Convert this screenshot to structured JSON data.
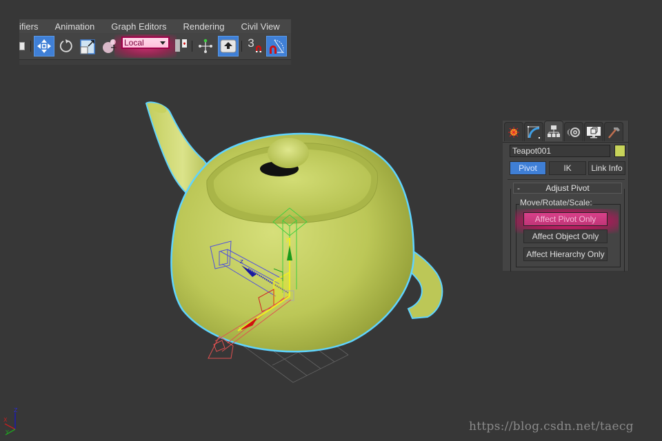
{
  "menubar": {
    "items": [
      "ifiers",
      "Animation",
      "Graph Editors",
      "Rendering",
      "Civil View"
    ]
  },
  "toolbar": {
    "tools": [
      {
        "name": "select-object",
        "icon": "cube-icon",
        "active": false
      },
      {
        "name": "select-and-move",
        "icon": "move-arrows-icon",
        "active": true
      },
      {
        "name": "select-and-rotate",
        "icon": "rotate-icon",
        "active": false
      },
      {
        "name": "select-and-scale",
        "icon": "scale-icon",
        "active": false
      },
      {
        "name": "select-and-place",
        "icon": "place-sphere-icon",
        "active": false
      },
      {
        "name": "use-pivot-point-center",
        "icon": "pivot-center-icon",
        "active": false
      },
      {
        "name": "select-manipulate",
        "icon": "manipulate-icon",
        "active": false
      },
      {
        "name": "keyboard-shortcut-override",
        "icon": "keyboard-override-icon",
        "active": true
      },
      {
        "name": "snaps-toggle",
        "icon": "snap-magnet-icon",
        "label": "3",
        "active": false
      },
      {
        "name": "angle-snap-toggle",
        "icon": "angle-snap-icon",
        "active": true
      }
    ],
    "reference_coordinate_system": {
      "selected": "Local"
    }
  },
  "viewport": {
    "object": "teapot",
    "axis_labels": {
      "x": "x",
      "y": "y",
      "z": "z"
    },
    "tripod_labels": {
      "x": "X",
      "y": "Y",
      "z": "Z"
    },
    "colors": {
      "teapot": "#bfca5a",
      "selection_outline": "#5fd4ff",
      "x_axis": "#e02020",
      "y_axis": "#20b020",
      "z_axis": "#2020d0",
      "gizmo_plane": "#f0f020"
    }
  },
  "command_panel": {
    "tabs": [
      {
        "name": "create",
        "icon": "create-star-icon",
        "active": false
      },
      {
        "name": "modify",
        "icon": "modify-curve-icon",
        "active": false
      },
      {
        "name": "hierarchy",
        "icon": "hierarchy-icon",
        "active": true
      },
      {
        "name": "motion",
        "icon": "motion-icon",
        "active": false
      },
      {
        "name": "display",
        "icon": "display-monitor-icon",
        "active": false
      },
      {
        "name": "utilities",
        "icon": "utilities-hammer-icon",
        "active": false
      }
    ],
    "object_name": "Teapot001",
    "object_color": "#c8d45a",
    "sub_tabs": [
      {
        "label": "Pivot",
        "active": true
      },
      {
        "label": "IK",
        "active": false
      },
      {
        "label": "Link Info",
        "active": false
      }
    ],
    "rollout": {
      "collapse_symbol": "-",
      "title": "Adjust Pivot",
      "group_label": "Move/Rotate/Scale:",
      "buttons": [
        {
          "label": "Affect Pivot Only",
          "highlighted": true
        },
        {
          "label": "Affect Object Only",
          "highlighted": false
        },
        {
          "label": "Affect Hierarchy Only",
          "highlighted": false
        }
      ]
    }
  },
  "watermark": "https://blog.csdn.net/taecg"
}
